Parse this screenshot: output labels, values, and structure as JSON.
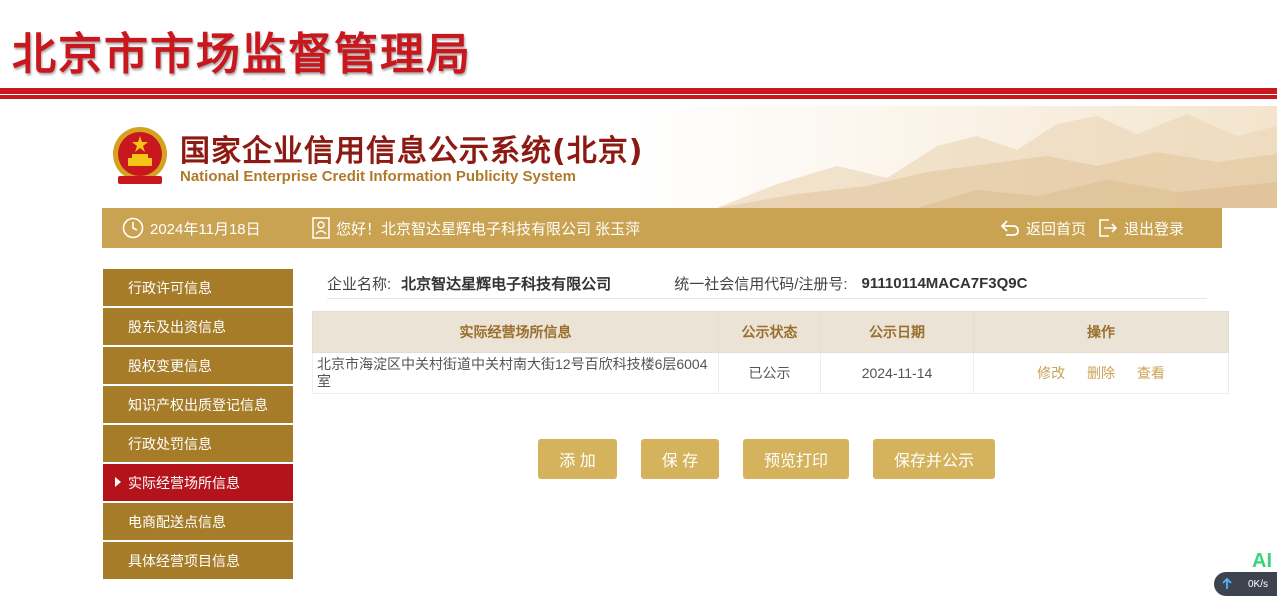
{
  "header": {
    "bureau_title": "北京市市场监督管理局",
    "system_title_cn": "国家企业信用信息公示系统(北京)",
    "system_title_en": "National Enterprise Credit Information Publicity System"
  },
  "info_bar": {
    "date": "2024年11月18日",
    "greeting": "您好！北京智达星辉电子科技有限公司 张玉萍",
    "home_link": "返回首页",
    "logout_link": "退出登录"
  },
  "sidebar": {
    "items": [
      {
        "label": "行政许可信息"
      },
      {
        "label": "股东及出资信息"
      },
      {
        "label": "股权变更信息"
      },
      {
        "label": "知识产权出质登记信息"
      },
      {
        "label": "行政处罚信息"
      },
      {
        "label": "实际经营场所信息",
        "active": true
      },
      {
        "label": "电商配送点信息"
      },
      {
        "label": "具体经营项目信息"
      }
    ]
  },
  "company": {
    "name_label": "企业名称:",
    "name": "北京智达星辉电子科技有限公司",
    "code_label": "统一社会信用代码/注册号:",
    "code": "91110114MACA7F3Q9C"
  },
  "table": {
    "headers": [
      "实际经营场所信息",
      "公示状态",
      "公示日期",
      "操作"
    ],
    "rows": [
      {
        "address": "北京市海淀区中关村街道中关村南大街12号百欣科技楼6层6004室",
        "status": "已公示",
        "date": "2024-11-14",
        "actions": [
          "修改",
          "删除",
          "查看"
        ]
      }
    ]
  },
  "buttons": {
    "add": "添 加",
    "save": "保 存",
    "preview_print": "预览打印",
    "save_publish": "保存并公示"
  },
  "overlay": {
    "ai_badge": "AI",
    "net_speed": "0K/s"
  },
  "colors": {
    "bureau_red": "#c8171d",
    "gold_bar": "#c9a352",
    "sidebar_gold": "#a67c28",
    "sidebar_active": "#b5131b",
    "button_gold": "#d4b35c",
    "table_header_bg": "#ebe3d5"
  },
  "icons": {
    "date": "clock-icon",
    "greeting": "user-card-icon",
    "home": "return-arrow-icon",
    "logout": "logout-icon",
    "emblem": "national-emblem-icon"
  }
}
